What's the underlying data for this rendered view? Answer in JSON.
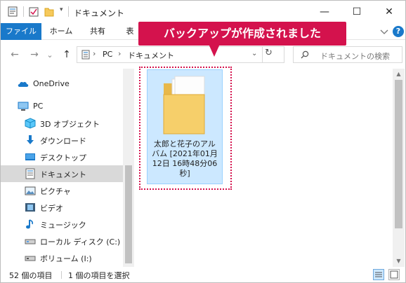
{
  "window": {
    "title": "ドキュメント",
    "controls": {
      "minimize": "—",
      "maximize": "☐",
      "close": "✕"
    }
  },
  "ribbon": {
    "tabs": [
      "ファイル",
      "ホーム",
      "共有",
      "表"
    ],
    "help": "?"
  },
  "navigation": {
    "back": "←",
    "forward": "→",
    "recent": "⌄",
    "up": "↑",
    "address": [
      "PC",
      "ドキュメント"
    ],
    "refresh": "↻",
    "search_placeholder": "ドキュメントの検索"
  },
  "sidebar": {
    "items": [
      {
        "label": "OneDrive",
        "icon": "onedrive-icon"
      },
      {
        "label": "PC",
        "icon": "pc-icon"
      },
      {
        "label": "3D オブジェクト",
        "icon": "3d-objects-icon"
      },
      {
        "label": "ダウンロード",
        "icon": "download-icon"
      },
      {
        "label": "デスクトップ",
        "icon": "desktop-icon"
      },
      {
        "label": "ドキュメント",
        "icon": "documents-icon",
        "selected": true
      },
      {
        "label": "ピクチャ",
        "icon": "pictures-icon"
      },
      {
        "label": "ビデオ",
        "icon": "videos-icon"
      },
      {
        "label": "ミュージック",
        "icon": "music-icon"
      },
      {
        "label": "ローカル ディスク (C:)",
        "icon": "local-disk-icon"
      },
      {
        "label": "ボリューム (I:)",
        "icon": "volume-icon"
      }
    ]
  },
  "content": {
    "file": {
      "name_lines": [
        "太郎と花子のアル",
        "バム [2021年01月",
        "12日 16時48分06",
        "秒]"
      ],
      "icon": "folder-icon"
    },
    "callout": "バックアップが作成されました"
  },
  "status": {
    "item_count": "52 個の項目",
    "selected_count": "1 個の項目を選択"
  },
  "colors": {
    "accent": "#1979ca",
    "callout": "#d4124d",
    "selection": "#cce8ff"
  }
}
